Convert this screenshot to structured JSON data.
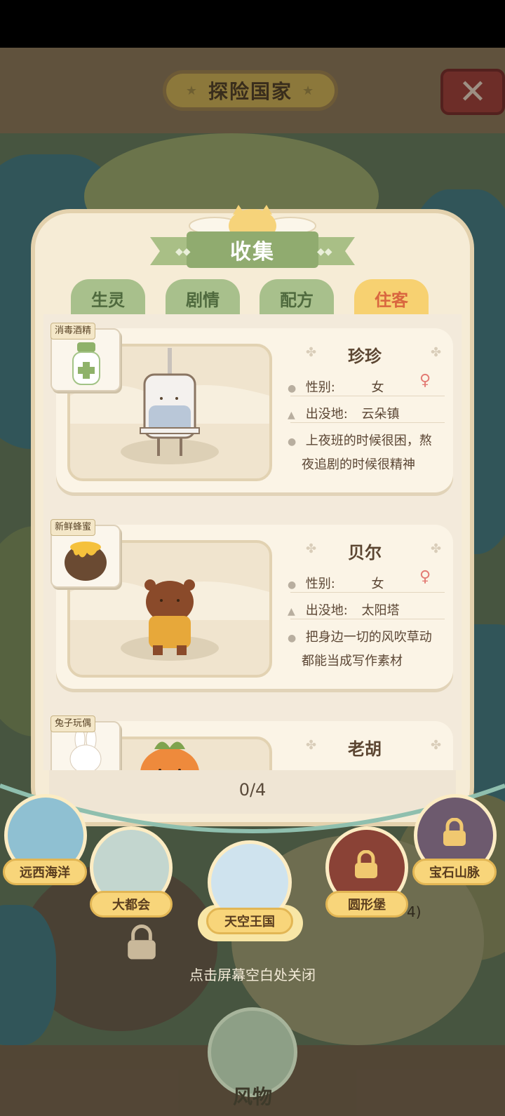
{
  "header": {
    "title": "探险国家",
    "close_icon": "close-icon"
  },
  "panel": {
    "title": "收集",
    "tabs": [
      {
        "label": "生灵",
        "active": false
      },
      {
        "label": "剧情",
        "active": false
      },
      {
        "label": "配方",
        "active": false
      },
      {
        "label": "住客",
        "active": true
      }
    ],
    "residents": [
      {
        "item": "消毒酒精",
        "name": "珍珍",
        "gender_label": "性别:",
        "gender": "女",
        "place_label": "出没地:",
        "place": "云朵镇",
        "desc1": "上夜班的时候很困，熬",
        "desc2": "夜追剧的时候很精神"
      },
      {
        "item": "新鲜蜂蜜",
        "name": "贝尔",
        "gender_label": "性别:",
        "gender": "女",
        "place_label": "出没地:",
        "place": "太阳塔",
        "desc1": "把身边一切的风吹草动",
        "desc2": "都能当成写作素材"
      },
      {
        "item": "兔子玩偶",
        "name": "老胡"
      }
    ],
    "progress": "0/4"
  },
  "regions": [
    {
      "label": "远西海洋",
      "locked": false
    },
    {
      "label": "大都会",
      "locked": false
    },
    {
      "label": "天空王国",
      "locked": false,
      "selected": true
    },
    {
      "label": "圆形堡",
      "locked": true
    },
    {
      "label": "宝石山脉",
      "locked": true
    }
  ],
  "hint": "点击屏幕空白处关闭",
  "bottom_button": {
    "label": "风物"
  },
  "background_partial": {
    "progress": "4)"
  },
  "colors": {
    "tab_active": "#f7d171",
    "tab_inactive": "#a8c08c",
    "panel": "#f6ecd6",
    "label": "#f8d57a"
  }
}
